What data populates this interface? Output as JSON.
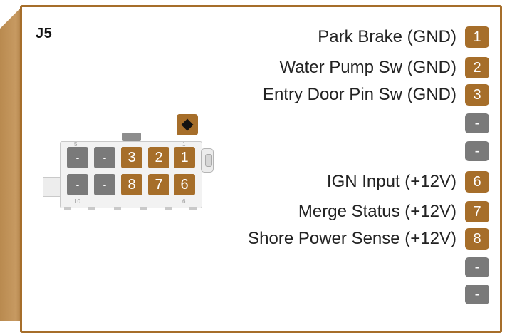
{
  "connector": {
    "name": "J5"
  },
  "pins": [
    {
      "label": "Park Brake (GND)",
      "badge": "1",
      "status": "active"
    },
    {
      "label": "Water Pump Sw (GND)",
      "badge": "2",
      "status": "active"
    },
    {
      "label": "Entry Door Pin Sw (GND)",
      "badge": "3",
      "status": "active"
    },
    {
      "label": "",
      "badge": "-",
      "status": "inactive"
    },
    {
      "label": "",
      "badge": "-",
      "status": "inactive"
    },
    {
      "label": "IGN Input (+12V)",
      "badge": "6",
      "status": "active"
    },
    {
      "label": "Merge Status (+12V)",
      "badge": "7",
      "status": "active"
    },
    {
      "label": "Shore Power Sense (+12V)",
      "badge": "8",
      "status": "active"
    },
    {
      "label": "",
      "badge": "-",
      "status": "inactive"
    },
    {
      "label": "",
      "badge": "-",
      "status": "inactive"
    }
  ],
  "cavity_grid": {
    "top_row": [
      "-",
      "-",
      "3",
      "2",
      "1"
    ],
    "bottom_row": [
      "-",
      "-",
      "8",
      "7",
      "6"
    ]
  },
  "markings": {
    "pin5": "5",
    "pin1": "1",
    "pin10": "10",
    "pin6": "6"
  },
  "colors": {
    "accent": "#a66e2a",
    "inactive": "#7a7a7a",
    "frame": "#c79a62"
  },
  "icons": {
    "key": "diamond-key-icon"
  }
}
